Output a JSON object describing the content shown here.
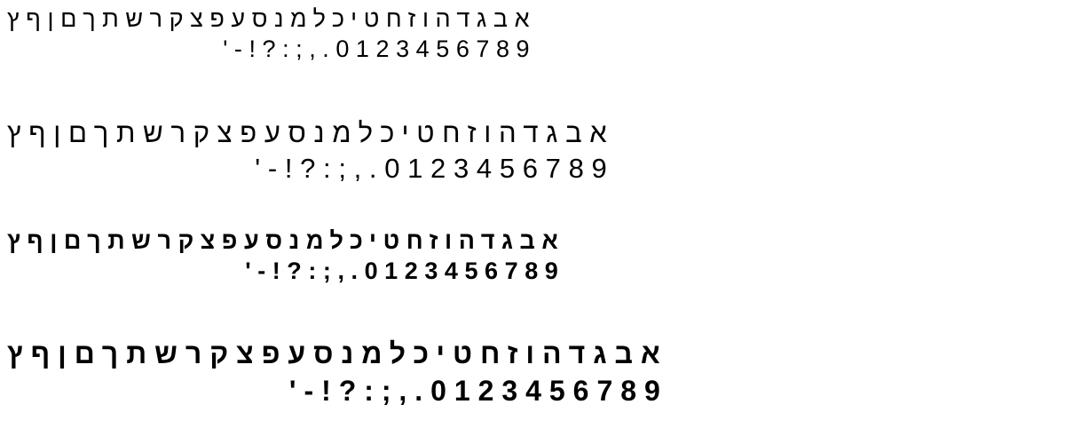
{
  "samples": [
    {
      "hebrew": "אבגדהוזחטיכלמנסעפצקרשתךםןףץ",
      "digits": "0123456789.,;:?!-'"
    },
    {
      "hebrew": "אבגדהוזחטיכלמנסעפצקרשתךםןףץ",
      "digits": "0123456789.,;:?!-'"
    },
    {
      "hebrew": "אבגדהוזחטיכלמנסעפצקרשתךםןףץ",
      "digits": "0123456789.,;:?!-'"
    },
    {
      "hebrew": "אבגדהוזחטיכלמנסעפצקרשתךםןףץ",
      "digits": "0123456789.,;:?!-'"
    }
  ]
}
